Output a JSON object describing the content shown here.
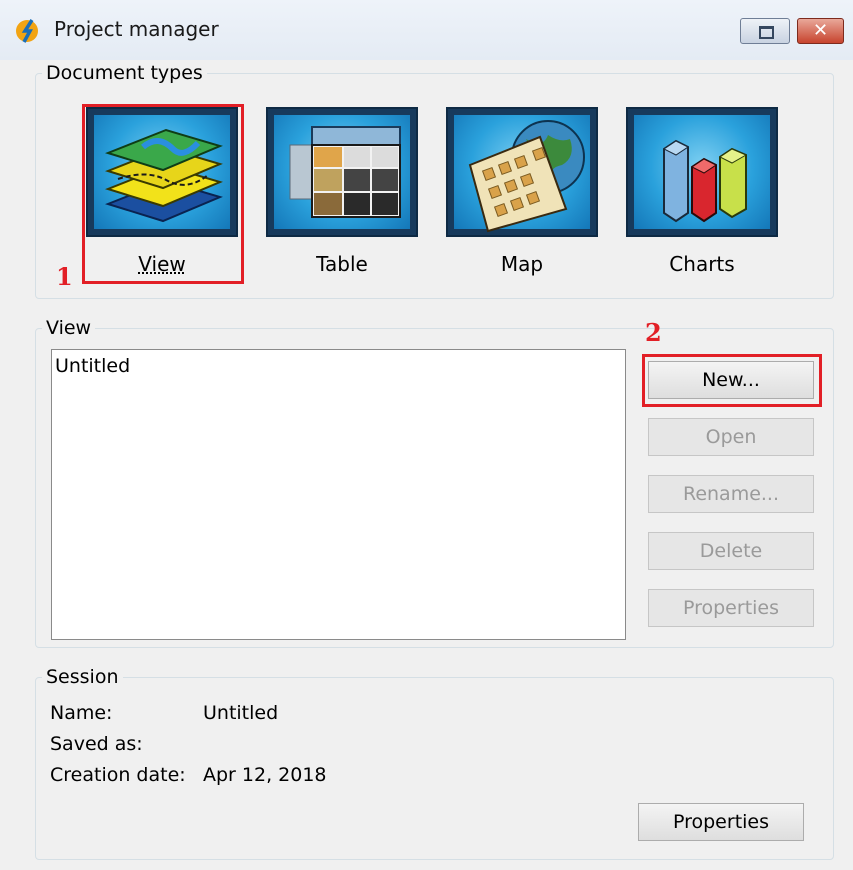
{
  "window": {
    "title": "Project manager"
  },
  "document_types": {
    "group_title": "Document types",
    "items": [
      {
        "label": "View",
        "icon": "layered-map-icon"
      },
      {
        "label": "Table",
        "icon": "table-icon"
      },
      {
        "label": "Map",
        "icon": "map-globe-icon"
      },
      {
        "label": "Charts",
        "icon": "bar-chart-icon"
      }
    ]
  },
  "view_section": {
    "group_title": "View",
    "documents": [
      "Untitled"
    ],
    "buttons": {
      "new": "New...",
      "open": "Open",
      "rename": "Rename...",
      "delete": "Delete",
      "properties": "Properties"
    }
  },
  "session": {
    "group_title": "Session",
    "name_label": "Name:",
    "name_value": "Untitled",
    "saved_as_label": "Saved as:",
    "saved_as_value": "",
    "creation_date_label": "Creation date:",
    "creation_date_value": "Apr 12, 2018",
    "properties_button": "Properties"
  },
  "annotations": {
    "step1": "1",
    "step2": "2"
  },
  "colors": {
    "highlight": "#e21f26",
    "tile_border": "#173a5c"
  }
}
